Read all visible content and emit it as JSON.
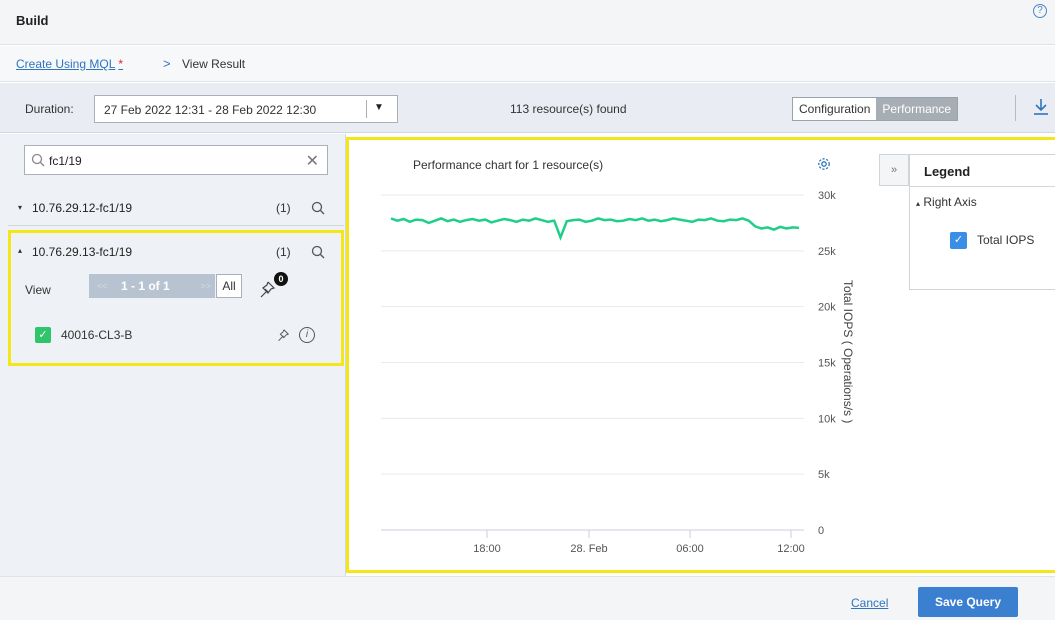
{
  "header": {
    "title": "Build",
    "help_icon": "help-circle-icon"
  },
  "breadcrumb": {
    "link": "Create Using MQL",
    "required_mark": "*",
    "separator": ">",
    "current": "View Result"
  },
  "toolbar": {
    "duration_label": "Duration:",
    "duration_value": "27 Feb 2022 12:31 - 28 Feb 2022 12:30",
    "found_text": "113 resource(s) found",
    "tabs": [
      "Configuration",
      "Performance"
    ],
    "active_tab": "Performance",
    "download_icon": "download-icon"
  },
  "sidebar": {
    "search_value": "fc1/19",
    "clear_label": "✕",
    "groups": [
      {
        "label": "10.76.29.12-fc1/19",
        "count": "(1)",
        "expanded": false
      },
      {
        "label": "10.76.29.13-fc1/19",
        "count": "(1)",
        "expanded": true
      }
    ],
    "view_label": "View",
    "pager_text": "1 - 1 of 1",
    "pager_prev": "<<",
    "pager_next": ">>",
    "all_label": "All",
    "pin_badge": "0",
    "resource": {
      "name": "40016-CL3-B",
      "checked": true
    }
  },
  "chart_data": {
    "type": "line",
    "title": "Performance chart for 1 resource(s)",
    "ylabel": "Total IOPS ( Operations/s )",
    "y_axis_side": "right",
    "ylim": [
      0,
      30000
    ],
    "y_ticks": [
      "0",
      "5k",
      "10k",
      "15k",
      "20k",
      "25k",
      "30k"
    ],
    "x_ticks": [
      "18:00",
      "28. Feb",
      "06:00",
      "12:00"
    ],
    "grid": true,
    "series": [
      {
        "name": "Total IOPS",
        "color": "#1ecf8a",
        "values": [
          27900,
          27700,
          27850,
          27600,
          27800,
          27750,
          27500,
          27700,
          27900,
          27650,
          27800,
          27600,
          27750,
          27850,
          27700,
          27800,
          27550,
          27700,
          27850,
          27750,
          27600,
          27800,
          27700,
          27900,
          27750,
          27600,
          27700,
          26200,
          27650,
          27750,
          27800,
          27600,
          27700,
          27900,
          27750,
          27800,
          27650,
          27700,
          27850,
          27750,
          27900,
          27700,
          27800,
          27650,
          27750,
          27900,
          27800,
          27700,
          27600,
          27800,
          27750,
          27900,
          27700,
          27650,
          27800,
          27750,
          27900,
          27700,
          27200,
          27000,
          27100,
          26900,
          27150,
          27000,
          27100,
          27050
        ]
      }
    ]
  },
  "legend": {
    "toggle": "»",
    "title": "Legend",
    "group": "Right Axis",
    "item": "Total IOPS",
    "item_checked": true
  },
  "footer": {
    "cancel": "Cancel",
    "save": "Save Query"
  }
}
